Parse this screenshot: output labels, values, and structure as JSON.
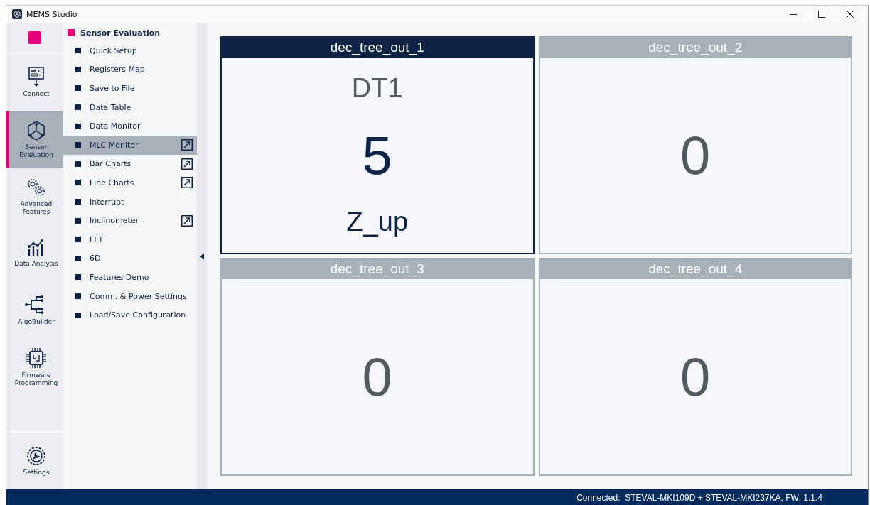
{
  "window": {
    "title": "MEMS Studio"
  },
  "nav_rail": [
    {
      "kind": "connect",
      "label": "Connect",
      "selected": false
    },
    {
      "kind": "sensor",
      "label": "Sensor Evaluation",
      "selected": true
    },
    {
      "kind": "advanced",
      "label": "Advanced Features",
      "selected": false
    },
    {
      "kind": "analysis",
      "label": "Data Analysis",
      "selected": false
    },
    {
      "kind": "algo",
      "label": "AlgoBuilder",
      "selected": false
    },
    {
      "kind": "firmware",
      "label": "Firmware Programming",
      "selected": false
    }
  ],
  "settings": {
    "label": "Settings"
  },
  "submenu": {
    "title": "Sensor Evaluation",
    "items": [
      {
        "label": "Quick Setup",
        "selected": false,
        "popout": false
      },
      {
        "label": "Registers Map",
        "selected": false,
        "popout": false
      },
      {
        "label": "Save to File",
        "selected": false,
        "popout": false
      },
      {
        "label": "Data Table",
        "selected": false,
        "popout": false
      },
      {
        "label": "Data Monitor",
        "selected": false,
        "popout": false
      },
      {
        "label": "MLC Monitor",
        "selected": true,
        "popout": true
      },
      {
        "label": "Bar Charts",
        "selected": false,
        "popout": true
      },
      {
        "label": "Line Charts",
        "selected": false,
        "popout": true
      },
      {
        "label": "Interrupt",
        "selected": false,
        "popout": false
      },
      {
        "label": "Inclinometer",
        "selected": false,
        "popout": true
      },
      {
        "label": "FFT",
        "selected": false,
        "popout": false
      },
      {
        "label": "6D",
        "selected": false,
        "popout": false
      },
      {
        "label": "Features Demo",
        "selected": false,
        "popout": false
      },
      {
        "label": "Comm. & Power Settings",
        "selected": false,
        "popout": false
      },
      {
        "label": "Load/Save Configuration",
        "selected": false,
        "popout": false
      }
    ]
  },
  "tiles": [
    {
      "title": "dec_tree_out_1",
      "selected": true,
      "name": "DT1",
      "value": "5",
      "label": "Z_up"
    },
    {
      "title": "dec_tree_out_2",
      "selected": false,
      "value": "0"
    },
    {
      "title": "dec_tree_out_3",
      "selected": false,
      "value": "0"
    },
    {
      "title": "dec_tree_out_4",
      "selected": false,
      "value": "0"
    }
  ],
  "status_bar": {
    "text": "Connected:  STEVAL-MKI109D + STEVAL-MKI237KA, FW: 1.1.4"
  }
}
